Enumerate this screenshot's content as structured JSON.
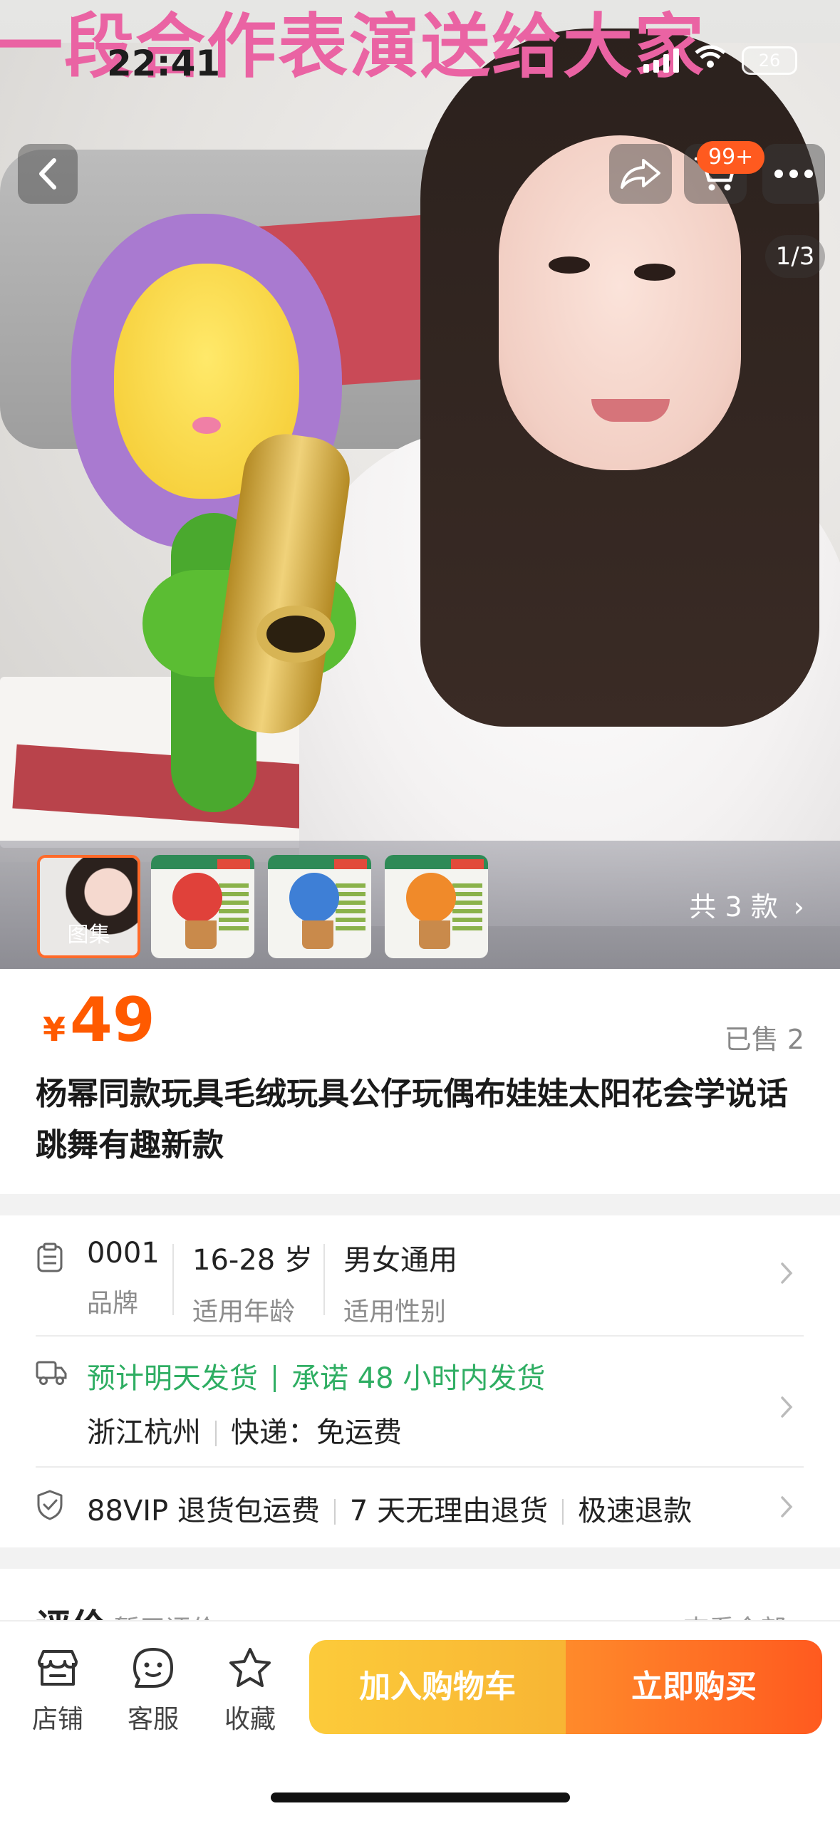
{
  "status": {
    "time": "22:41",
    "battery": "26"
  },
  "hero": {
    "banner": "一段合作表演送给大家",
    "cart_badge": "99+",
    "page_indicator": "1/3",
    "thumbnails": [
      {
        "label": "图集"
      },
      {
        "label": ""
      },
      {
        "label": ""
      },
      {
        "label": ""
      }
    ],
    "styles_count": "共 3 款",
    "chevron": "›"
  },
  "product": {
    "currency": "¥",
    "price": "49",
    "sold": "已售 2",
    "title": "杨幂同款玩具毛绒玩具公仔玩偶布娃娃太阳花会学说话跳舞有趣新款"
  },
  "specs": {
    "items": [
      {
        "value": "0001",
        "label": "品牌"
      },
      {
        "value": "16-28 岁",
        "label": "适用年龄"
      },
      {
        "value": "男女通用",
        "label": "适用性别"
      }
    ]
  },
  "shipping": {
    "estimate": "预计明天发货",
    "promise": "承诺 48 小时内发货",
    "origin": "浙江杭州",
    "delivery": "快递：免运费"
  },
  "guarantee": {
    "items": [
      "88VIP 退货包运费",
      "7 天无理由退货",
      "极速退款"
    ]
  },
  "reviews": {
    "title": "评价",
    "subtitle": "暂无评价",
    "more": "查看全部 ›"
  },
  "bottom": {
    "shop": "店铺",
    "service": "客服",
    "favorite": "收藏",
    "add_cart": "加入购物车",
    "buy_now": "立即购买"
  },
  "colors": {
    "accent": "#ff5a1f",
    "price": "#ff5a00",
    "ship_green": "#2fae63",
    "cart_yellow": "#fccb3a"
  },
  "icons": [
    "back-icon",
    "share-icon",
    "cart-icon",
    "more-icon",
    "spec-icon",
    "truck-icon",
    "shield-icon",
    "shop-icon",
    "service-icon",
    "star-icon"
  ]
}
